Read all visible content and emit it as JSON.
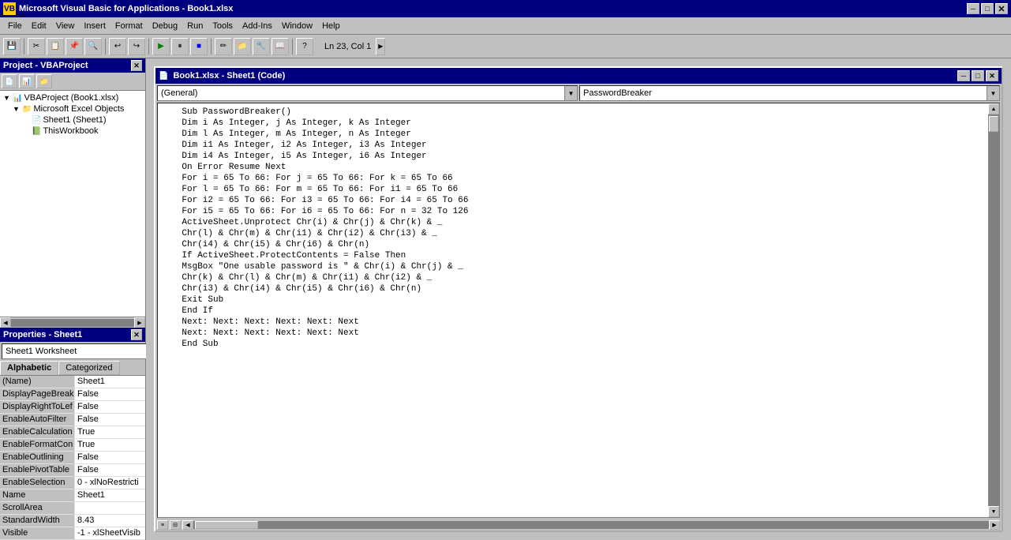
{
  "titleBar": {
    "icon": "VBA",
    "title": "Microsoft Visual Basic for Applications - Book1.xlsx",
    "minimize": "─",
    "maximize": "□",
    "close": "✕"
  },
  "menuBar": {
    "items": [
      "File",
      "Edit",
      "View",
      "Insert",
      "Format",
      "Debug",
      "Run",
      "Tools",
      "Add-Ins",
      "Window",
      "Help"
    ]
  },
  "toolbar": {
    "status": "Ln 23, Col 1",
    "buttons": [
      "💾",
      "✂",
      "📋",
      "↩",
      "↪",
      "▶",
      "⏸",
      "⏹",
      "🔧",
      "?"
    ]
  },
  "leftPanel": {
    "projectTitle": "Project - VBAProject",
    "projectTree": {
      "items": [
        {
          "indent": 0,
          "expand": "▼",
          "icon": "📊",
          "label": "VBAProject (Book1.xlsx)",
          "selected": false
        },
        {
          "indent": 1,
          "expand": "▼",
          "icon": "📁",
          "label": "Microsoft Excel Objects",
          "selected": false
        },
        {
          "indent": 2,
          "expand": "",
          "icon": "📄",
          "label": "Sheet1 (Sheet1)",
          "selected": false
        },
        {
          "indent": 2,
          "expand": "",
          "icon": "📗",
          "label": "ThisWorkbook",
          "selected": false
        }
      ]
    },
    "propertiesTitle": "Properties - Sheet1",
    "objectSelector": "Sheet1  Worksheet",
    "tabs": [
      "Alphabetic",
      "Categorized"
    ],
    "activeTab": "Alphabetic",
    "properties": [
      {
        "name": "(Name)",
        "value": "Sheet1"
      },
      {
        "name": "DisplayPageBreak",
        "value": "False"
      },
      {
        "name": "DisplayRightToLef",
        "value": "False"
      },
      {
        "name": "EnableAutoFilter",
        "value": "False"
      },
      {
        "name": "EnableCalculation",
        "value": "True"
      },
      {
        "name": "EnableFormatCon",
        "value": "True"
      },
      {
        "name": "EnableOutlining",
        "value": "False"
      },
      {
        "name": "EnablePivotTable",
        "value": "False"
      },
      {
        "name": "EnableSelection",
        "value": "0 - xlNoRestricti"
      },
      {
        "name": "Name",
        "value": "Sheet1"
      },
      {
        "name": "ScrollArea",
        "value": ""
      },
      {
        "name": "StandardWidth",
        "value": "8.43"
      },
      {
        "name": "Visible",
        "value": "-1 - xlSheetVisibl"
      }
    ]
  },
  "codeWindow": {
    "title": "Book1.xlsx - Sheet1 (Code)",
    "dropdownLeft": "(General)",
    "dropdownRight": "PasswordBreaker",
    "code": "    Sub PasswordBreaker()\n    Dim i As Integer, j As Integer, k As Integer\n    Dim l As Integer, m As Integer, n As Integer\n    Dim i1 As Integer, i2 As Integer, i3 As Integer\n    Dim i4 As Integer, i5 As Integer, i6 As Integer\n    On Error Resume Next\n    For i = 65 To 66: For j = 65 To 66: For k = 65 To 66\n    For l = 65 To 66: For m = 65 To 66: For i1 = 65 To 66\n    For i2 = 65 To 66: For i3 = 65 To 66: For i4 = 65 To 66\n    For i5 = 65 To 66: For i6 = 65 To 66: For n = 32 To 126\n    ActiveSheet.Unprotect Chr(i) & Chr(j) & Chr(k) & _\n    Chr(l) & Chr(m) & Chr(i1) & Chr(i2) & Chr(i3) & _\n    Chr(i4) & Chr(i5) & Chr(i6) & Chr(n)\n    If ActiveSheet.ProtectContents = False Then\n    MsgBox \"One usable password is \" & Chr(i) & Chr(j) & _\n    Chr(k) & Chr(l) & Chr(m) & Chr(i1) & Chr(i2) & _\n    Chr(i3) & Chr(i4) & Chr(i5) & Chr(i6) & Chr(n)\n    Exit Sub\n    End If\n    Next: Next: Next: Next: Next: Next\n    Next: Next: Next: Next: Next: Next\n    End Sub"
  }
}
